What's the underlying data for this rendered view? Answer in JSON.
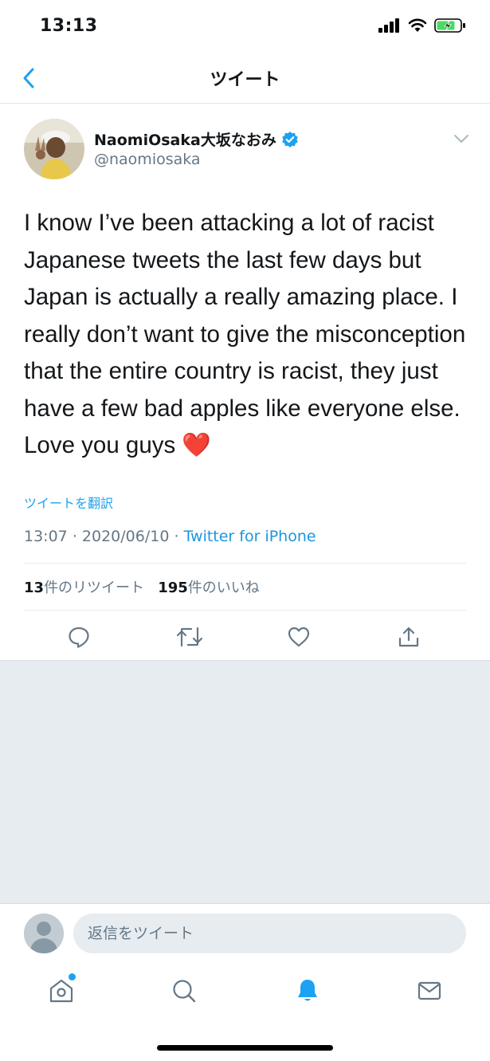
{
  "status_bar": {
    "time": "13:13"
  },
  "nav": {
    "title": "ツイート"
  },
  "tweet": {
    "display_name": "NaomiOsaka大坂なおみ",
    "handle": "@naomiosaka",
    "text": "I know I’ve been attacking a lot of racist Japanese tweets the last few days but Japan is actually a really amazing place. I really don’t want to give the misconception that the entire country is racist, they just have a few bad apples like everyone else. Love you guys ❤️",
    "translate_label": "ツイートを翻訳",
    "time": "13:07",
    "date": "2020/06/10",
    "separator": "·",
    "source": "Twitter for iPhone",
    "retweet_count": "13",
    "retweet_label": "件のリツイート",
    "like_count": "195",
    "like_label": "件のいいね"
  },
  "reply": {
    "placeholder": "返信をツイート"
  },
  "colors": {
    "accent": "#1da1f2",
    "secondary_text": "#657786",
    "background_gray": "#e6ecf0"
  }
}
